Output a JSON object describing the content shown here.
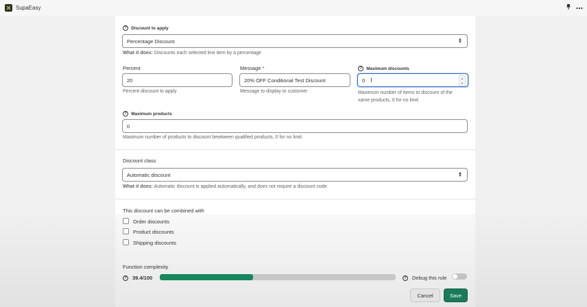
{
  "app": {
    "name": "SupaEasy",
    "icons": [
      "pin-icon",
      "more-icon"
    ]
  },
  "discount_to_apply": {
    "label": "Discount to apply",
    "value": "Percentage Discount",
    "what_it_does_prefix": "What it does:",
    "what_it_does_text": " Discounts each selected line item by a percentage"
  },
  "percent": {
    "label": "Percent",
    "value": "20",
    "help": "Percent discount to apply"
  },
  "message": {
    "label": "Message",
    "required_mark": "*",
    "value": "20% OFF Conditional Test Discount",
    "help": "Message to display to customer"
  },
  "max_discounts": {
    "label": "Maximum discounts",
    "value": "0",
    "help_line1": "Maximum number of items to discount of the",
    "help_line2": "same products, 0 for no limit."
  },
  "max_products": {
    "label": "Maximum products",
    "value": "0",
    "help": "Maximum number of products to discount bewtween qualified products, 0 for no limit."
  },
  "discount_class": {
    "label": "Discount class",
    "value": "Automatic discount",
    "what_it_does_prefix": "What it does:",
    "what_it_does_text": " Automatic discount is applied automatically, and does not require a discount code"
  },
  "combine": {
    "label": "This discount can be combined with",
    "options": [
      {
        "label": "Order discounts",
        "checked": false
      },
      {
        "label": "Product discounts",
        "checked": false
      },
      {
        "label": "Shipping discounts",
        "checked": false
      }
    ]
  },
  "complexity": {
    "label": "Function complexity",
    "value_text": "39.4/100",
    "value": 39.4,
    "max": 100
  },
  "debug": {
    "label": "Debug this rule",
    "on": false
  },
  "actions": {
    "cancel": "Cancel",
    "save": "Save"
  },
  "colors": {
    "accent": "#1a7b5a",
    "progress": "#16875f",
    "focus": "#2c6ecb"
  }
}
